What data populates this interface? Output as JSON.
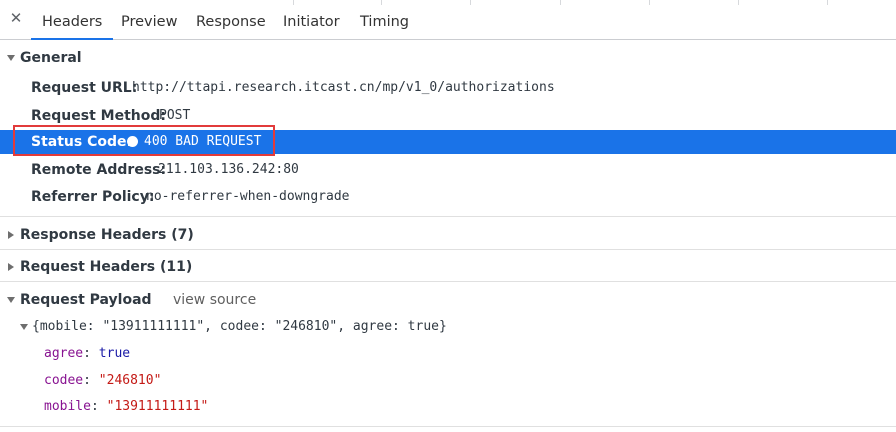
{
  "tabs": {
    "close_glyph": "✕",
    "items": [
      "Headers",
      "Preview",
      "Response",
      "Initiator",
      "Timing"
    ],
    "active": "Headers"
  },
  "general": {
    "title": "General",
    "request_url_label": "Request URL:",
    "request_url": "http://ttapi.research.itcast.cn/mp/v1_0/authorizations",
    "request_method_label": "Request Method:",
    "request_method": "POST",
    "status_code_label": "Status Code:",
    "status_code": "400 BAD REQUEST",
    "remote_address_label": "Remote Address:",
    "remote_address": "211.103.136.242:80",
    "referrer_policy_label": "Referrer Policy:",
    "referrer_policy": "no-referrer-when-downgrade"
  },
  "response_headers": {
    "title": "Response Headers (7)"
  },
  "request_headers": {
    "title": "Request Headers (11)"
  },
  "payload": {
    "title": "Request Payload",
    "view_source": "view source",
    "summary": "{mobile: \"13911111111\", codee: \"246810\", agree: true}",
    "fields": [
      {
        "key": "agree",
        "value": "true",
        "type": "bool"
      },
      {
        "key": "codee",
        "value": "\"246810\"",
        "type": "string"
      },
      {
        "key": "mobile",
        "value": "\"13911111111\"",
        "type": "string"
      }
    ]
  },
  "colors": {
    "selected_row": "#1a73e8",
    "highlight_border": "#e23b3b",
    "payload_key": "#881391",
    "payload_string": "#c41a16",
    "payload_bool": "#1a1aa6"
  }
}
